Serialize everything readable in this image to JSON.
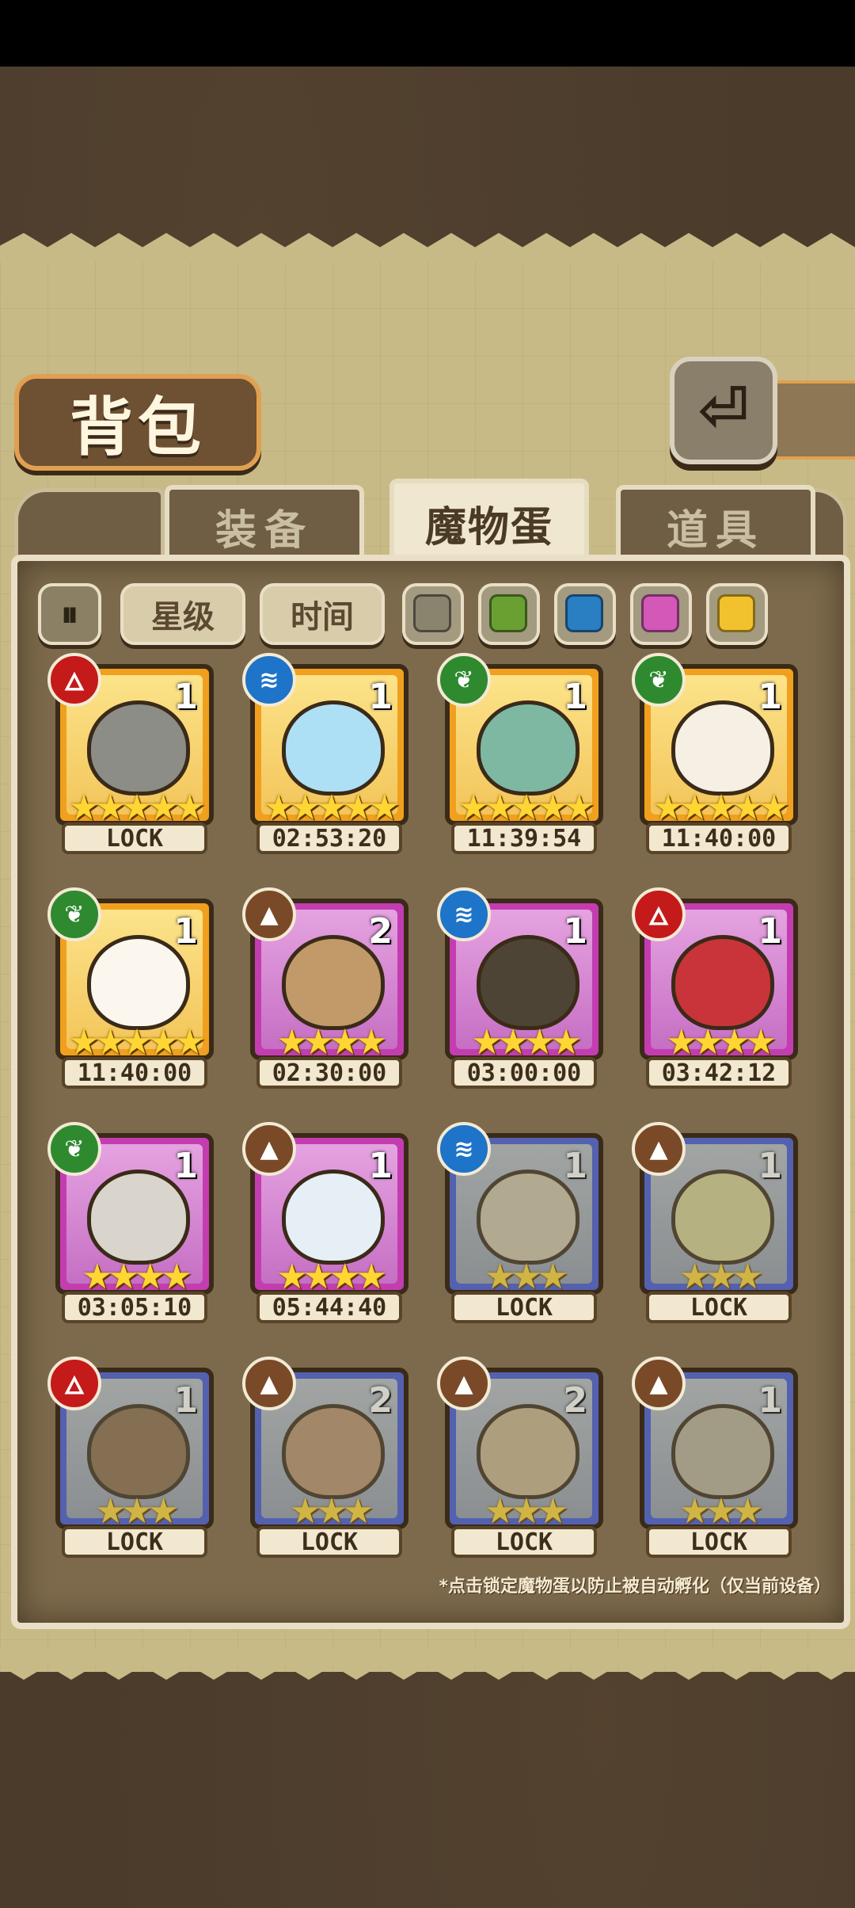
{
  "title": "背包",
  "tabs": [
    {
      "label": "装备",
      "active": false
    },
    {
      "label": "魔物蛋",
      "active": true
    },
    {
      "label": "道具",
      "active": false
    }
  ],
  "filters": {
    "sort_icon": "sort-toggle-icon",
    "star_label": "星级",
    "time_label": "时间",
    "color_swatches": [
      "#8a846f",
      "#6aa032",
      "#2a7ec2",
      "#d458b8",
      "#f2c22e"
    ]
  },
  "eggs": [
    {
      "element": "fire",
      "count": "1",
      "stars": "★★★★★",
      "rarity": "gold",
      "label": "LOCK",
      "locked": false,
      "color": "#8b8d86"
    },
    {
      "element": "water",
      "count": "1",
      "stars": "★★★★★",
      "rarity": "gold",
      "label": "02:53:20",
      "locked": false,
      "color": "#aee0f5"
    },
    {
      "element": "grass",
      "count": "1",
      "stars": "★★★★★",
      "rarity": "gold",
      "label": "11:39:54",
      "locked": false,
      "color": "#7fb8a2"
    },
    {
      "element": "grass",
      "count": "1",
      "stars": "★★★★★",
      "rarity": "gold",
      "label": "11:40:00",
      "locked": false,
      "color": "#f5efe4"
    },
    {
      "element": "grass",
      "count": "1",
      "stars": "★★★★★",
      "rarity": "gold",
      "label": "11:40:00",
      "locked": false,
      "color": "#fbf7ee"
    },
    {
      "element": "earth",
      "count": "2",
      "stars": "★★★★",
      "rarity": "purple",
      "label": "02:30:00",
      "locked": false,
      "color": "#c29a6a"
    },
    {
      "element": "water",
      "count": "1",
      "stars": "★★★★",
      "rarity": "purple",
      "label": "03:00:00",
      "locked": false,
      "color": "#4d4436"
    },
    {
      "element": "fire",
      "count": "1",
      "stars": "★★★★",
      "rarity": "purple",
      "label": "03:42:12",
      "locked": false,
      "color": "#c8343a"
    },
    {
      "element": "grass",
      "count": "1",
      "stars": "★★★★",
      "rarity": "purple",
      "label": "03:05:10",
      "locked": false,
      "color": "#d9d4cc"
    },
    {
      "element": "earth",
      "count": "1",
      "stars": "★★★★",
      "rarity": "purple",
      "label": "05:44:40",
      "locked": false,
      "color": "#e6eef6"
    },
    {
      "element": "water",
      "count": "1",
      "stars": "★★★",
      "rarity": "blue",
      "label": "LOCK",
      "locked": true,
      "color": "#cfc4a8"
    },
    {
      "element": "earth",
      "count": "1",
      "stars": "★★★",
      "rarity": "blue",
      "label": "LOCK",
      "locked": true,
      "color": "#d8cf90"
    },
    {
      "element": "fire",
      "count": "1",
      "stars": "★★★",
      "rarity": "blue",
      "label": "LOCK",
      "locked": true,
      "color": "#8a6a4a"
    },
    {
      "element": "earth",
      "count": "2",
      "stars": "★★★",
      "rarity": "blue",
      "label": "LOCK",
      "locked": true,
      "color": "#b8906a"
    },
    {
      "element": "earth",
      "count": "2",
      "stars": "★★★",
      "rarity": "blue",
      "label": "LOCK",
      "locked": true,
      "color": "#c9b48c"
    },
    {
      "element": "earth",
      "count": "1",
      "stars": "★★★",
      "rarity": "blue",
      "label": "LOCK",
      "locked": true,
      "color": "#b8ae98"
    }
  ],
  "element_icons": {
    "fire": "🜂",
    "water": "≋",
    "grass": "❦",
    "earth": "▲"
  },
  "footnote": "*点击锁定魔物蛋以防止被自动孵化（仅当前设备）"
}
